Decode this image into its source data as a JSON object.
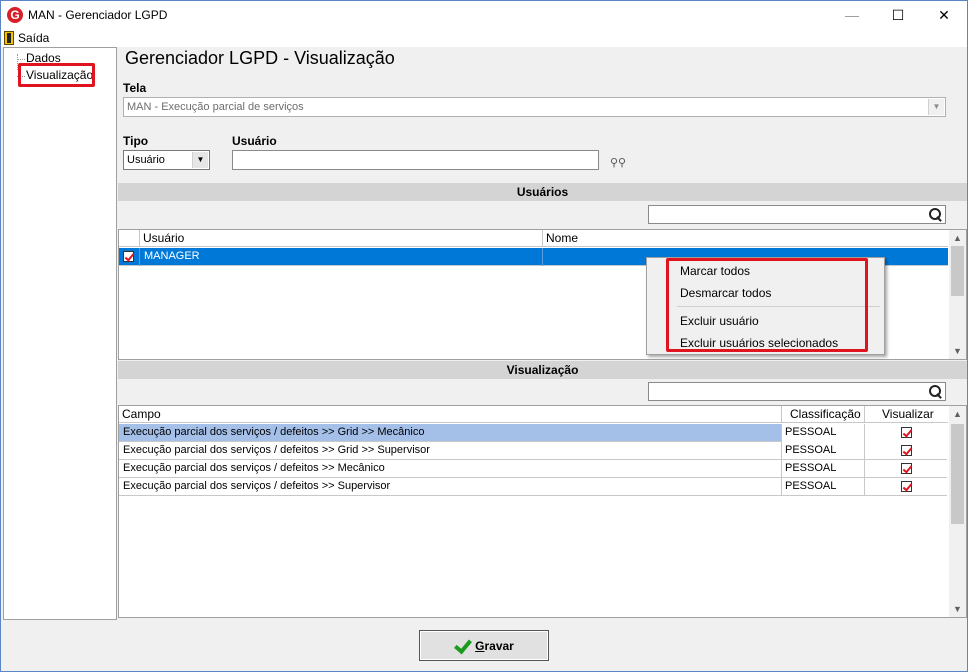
{
  "window": {
    "title": "MAN - Gerenciador LGPD",
    "app_icon_letter": "G",
    "minimize": "—",
    "maximize": "☐",
    "close": "✕"
  },
  "menu": {
    "exit_label": "Saída"
  },
  "tree": {
    "items": [
      {
        "label": "Dados"
      },
      {
        "label": "Visualização"
      }
    ]
  },
  "main": {
    "heading": "Gerenciador LGPD - Visualização",
    "tela_label": "Tela",
    "tela_value": "MAN - Execução parcial de serviços",
    "tipo_label": "Tipo",
    "tipo_value": "Usuário",
    "usuario_label": "Usuário",
    "usuario_value": ""
  },
  "users_section": {
    "title": "Usuários",
    "search_value": "",
    "columns": [
      "",
      "Usuário",
      "Nome"
    ],
    "rows": [
      {
        "checked": true,
        "usuario": "MANAGER",
        "nome": ""
      }
    ]
  },
  "context_menu": {
    "items": [
      {
        "label": "Marcar todos"
      },
      {
        "label": "Desmarcar todos"
      },
      {
        "label": "Excluir usuário"
      },
      {
        "label": "Excluir usuários selecionados"
      }
    ]
  },
  "view_section": {
    "title": "Visualização",
    "search_value": "",
    "columns": [
      "Campo",
      "Classificação",
      "Visualizar"
    ],
    "rows": [
      {
        "campo": "Execução parcial dos serviços / defeitos >> Grid >> Mecânico",
        "classificacao": "PESSOAL",
        "visualizar": true
      },
      {
        "campo": "Execução parcial dos serviços / defeitos >> Grid >> Supervisor",
        "classificacao": "PESSOAL",
        "visualizar": true
      },
      {
        "campo": "Execução parcial dos serviços / defeitos >> Mecânico",
        "classificacao": "PESSOAL",
        "visualizar": true
      },
      {
        "campo": "Execução parcial dos serviços / defeitos >> Supervisor",
        "classificacao": "PESSOAL",
        "visualizar": true
      }
    ]
  },
  "footer": {
    "save_label": "Gravar"
  },
  "colors": {
    "selection": "#0078d7",
    "row_highlight": "#a4bfe8",
    "annotation": "#e0141e",
    "section_bar": "#d4d4d4"
  }
}
